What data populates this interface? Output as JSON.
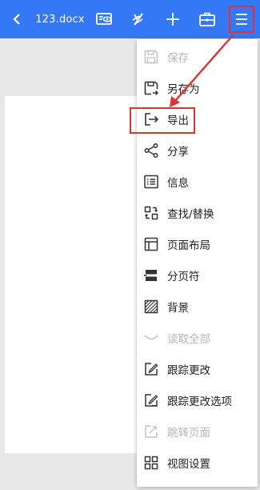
{
  "toolbar": {
    "back_icon": "back-arrow-icon",
    "title": "123.docx",
    "icons": [
      "read-mode-icon",
      "pen-icon",
      "add-icon",
      "toolbox-icon",
      "menu-icon"
    ],
    "color": "#3478f6"
  },
  "menu": {
    "items": [
      {
        "label": "保存",
        "icon": "save-icon",
        "enabled": false
      },
      {
        "label": "另存为",
        "icon": "save-as-icon",
        "enabled": true
      },
      {
        "label": "导出",
        "icon": "export-icon",
        "enabled": true
      },
      {
        "label": "分享",
        "icon": "share-icon",
        "enabled": true
      },
      {
        "label": "信息",
        "icon": "info-list-icon",
        "enabled": true
      },
      {
        "label": "查找/替换",
        "icon": "find-replace-icon",
        "enabled": true
      },
      {
        "label": "页面布局",
        "icon": "page-layout-icon",
        "enabled": true
      },
      {
        "label": "分页符",
        "icon": "page-break-icon",
        "enabled": true
      },
      {
        "label": "背景",
        "icon": "background-icon",
        "enabled": true
      },
      {
        "label": "读取全部",
        "icon": "read-all-icon",
        "enabled": false
      },
      {
        "label": "跟踪更改",
        "icon": "track-changes-icon",
        "enabled": true
      },
      {
        "label": "跟踪更改选项",
        "icon": "track-changes-options-icon",
        "enabled": true
      },
      {
        "label": "跳转页面",
        "icon": "go-to-page-icon",
        "enabled": false
      },
      {
        "label": "视图设置",
        "icon": "view-settings-icon",
        "enabled": true
      }
    ]
  },
  "annotation_color": "#e03232"
}
